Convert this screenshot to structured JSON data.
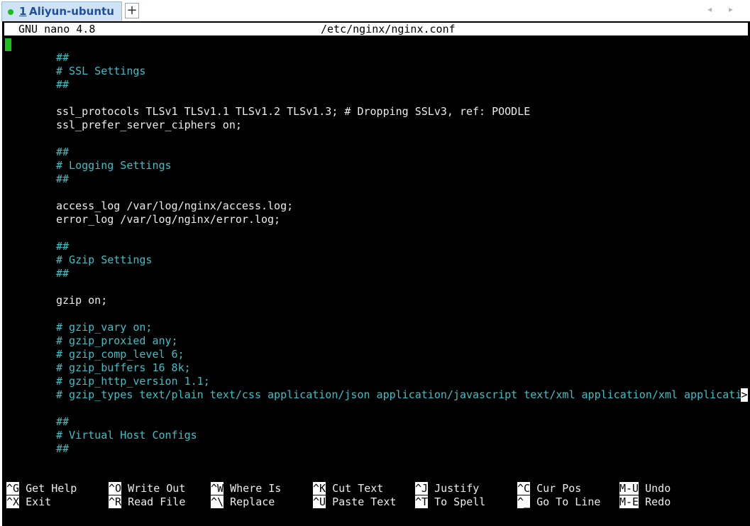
{
  "tabbar": {
    "tab": {
      "number": "1",
      "title": "Aliyun-ubuntu"
    },
    "new_tab_label": "+",
    "arrows": "◂ ▸"
  },
  "editor": {
    "app_version": "GNU nano 4.8",
    "filename": "/etc/nginx/nginx.conf",
    "truncation_marker": ">",
    "lines": [
      {
        "text": "##",
        "kind": "comment"
      },
      {
        "text": "# SSL Settings",
        "kind": "comment"
      },
      {
        "text": "##",
        "kind": "comment"
      },
      {
        "text": "",
        "kind": "code"
      },
      {
        "text": "ssl_protocols TLSv1 TLSv1.1 TLSv1.2 TLSv1.3; # Dropping SSLv3, ref: POODLE",
        "kind": "code"
      },
      {
        "text": "ssl_prefer_server_ciphers on;",
        "kind": "code"
      },
      {
        "text": "",
        "kind": "code"
      },
      {
        "text": "##",
        "kind": "comment"
      },
      {
        "text": "# Logging Settings",
        "kind": "comment"
      },
      {
        "text": "##",
        "kind": "comment"
      },
      {
        "text": "",
        "kind": "code"
      },
      {
        "text": "access_log /var/log/nginx/access.log;",
        "kind": "code"
      },
      {
        "text": "error_log /var/log/nginx/error.log;",
        "kind": "code"
      },
      {
        "text": "",
        "kind": "code"
      },
      {
        "text": "##",
        "kind": "comment"
      },
      {
        "text": "# Gzip Settings",
        "kind": "comment"
      },
      {
        "text": "##",
        "kind": "comment"
      },
      {
        "text": "",
        "kind": "code"
      },
      {
        "text": "gzip on;",
        "kind": "code"
      },
      {
        "text": "",
        "kind": "code"
      },
      {
        "text": "# gzip_vary on;",
        "kind": "comment"
      },
      {
        "text": "# gzip_proxied any;",
        "kind": "comment"
      },
      {
        "text": "# gzip_comp_level 6;",
        "kind": "comment"
      },
      {
        "text": "# gzip_buffers 16 8k;",
        "kind": "comment"
      },
      {
        "text": "# gzip_http_version 1.1;",
        "kind": "comment"
      },
      {
        "text": "# gzip_types text/plain text/css application/json application/javascript text/xml application/xml applicati",
        "kind": "comment"
      },
      {
        "text": "",
        "kind": "code"
      },
      {
        "text": "##",
        "kind": "comment"
      },
      {
        "text": "# Virtual Host Configs",
        "kind": "comment"
      },
      {
        "text": "##",
        "kind": "comment"
      }
    ],
    "shortcuts": [
      [
        {
          "key": "^G",
          "label": "Get Help"
        },
        {
          "key": "^X",
          "label": "Exit"
        }
      ],
      [
        {
          "key": "^O",
          "label": "Write Out"
        },
        {
          "key": "^R",
          "label": "Read File"
        }
      ],
      [
        {
          "key": "^W",
          "label": "Where Is"
        },
        {
          "key": "^\\",
          "label": "Replace"
        }
      ],
      [
        {
          "key": "^K",
          "label": "Cut Text"
        },
        {
          "key": "^U",
          "label": "Paste Text"
        }
      ],
      [
        {
          "key": "^J",
          "label": "Justify"
        },
        {
          "key": "^T",
          "label": "To Spell"
        }
      ],
      [
        {
          "key": "^C",
          "label": "Cur Pos"
        },
        {
          "key": "^_",
          "label": "Go To Line"
        }
      ],
      [
        {
          "key": "M-U",
          "label": "Undo"
        },
        {
          "key": "M-E",
          "label": "Redo"
        }
      ]
    ]
  },
  "colors": {
    "terminal_bg": "#000000",
    "comment": "#39c1c8",
    "code": "#ececec",
    "cursor": "#19c019",
    "tab_bg": "#cfe3f4"
  }
}
